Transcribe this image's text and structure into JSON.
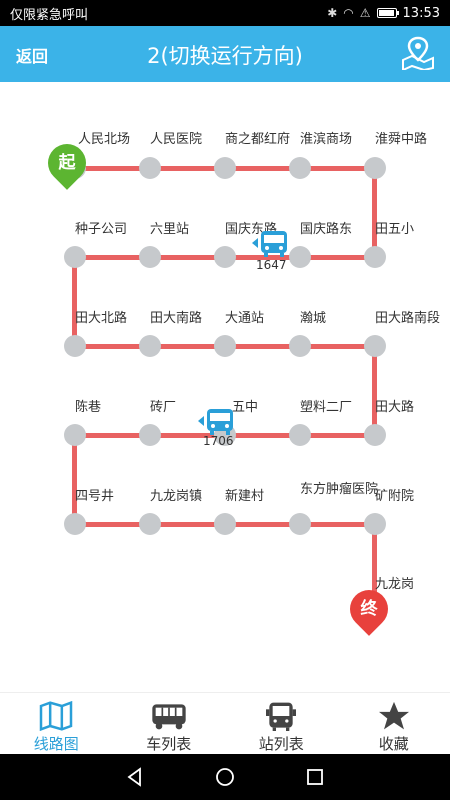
{
  "status": {
    "left_text": "仅限紧急呼叫",
    "time": "13:53",
    "battery_level_pct": 85
  },
  "header": {
    "back_label": "返回",
    "title": "2(切换运行方向)"
  },
  "route": {
    "start_badge": "起",
    "end_badge": "终",
    "stops": [
      "人民北场",
      "人民医院",
      "商之都红府",
      "淮滨商场",
      "淮舜中路",
      "田五小",
      "国庆路东",
      "国庆东路",
      "六里站",
      "种子公司",
      "田大北路",
      "田大南路",
      "大通站",
      "瀚城",
      "田大路南段",
      "田大路",
      "塑料二厂",
      "五中",
      "砖厂",
      "陈巷",
      "四号井",
      "九龙岗镇",
      "新建村",
      "东方肿瘤医院",
      "矿附院",
      "九龙岗"
    ],
    "buses": [
      {
        "id": "1647"
      },
      {
        "id": "1706"
      }
    ]
  },
  "tabs": [
    {
      "label": "线路图",
      "icon": "map-icon",
      "active": true
    },
    {
      "label": "车列表",
      "icon": "bus-icon",
      "active": false
    },
    {
      "label": "站列表",
      "icon": "station-icon",
      "active": false
    },
    {
      "label": "收藏",
      "icon": "star-icon",
      "active": false
    }
  ],
  "colors": {
    "accent": "#3bb3e8",
    "route_line": "#e86262",
    "start": "#5cb531",
    "end": "#e8413c",
    "stop": "#c6c9cc"
  }
}
